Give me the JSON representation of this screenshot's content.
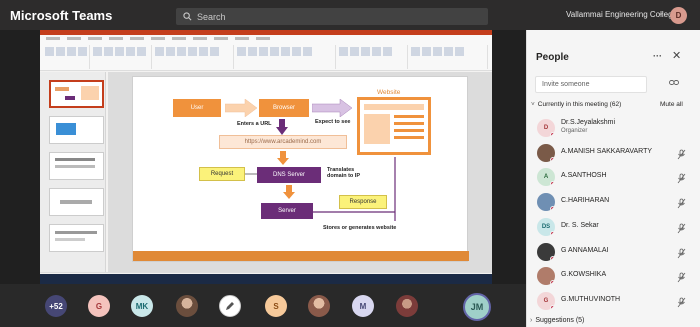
{
  "app": {
    "title": "Microsoft Teams",
    "search_placeholder": "Search",
    "org_name": "Vallammai Engineering College",
    "org_chevron": "⌄",
    "user_initials": "D"
  },
  "slide": {
    "user": "User",
    "browser": "Browser",
    "website": "Website",
    "expect": "Expect to see",
    "enters_url": "Enters a URL",
    "url": "https://www.arcademind.com",
    "request": "Request",
    "dns_server": "DNS Server",
    "translates": "Translates domain to IP",
    "response": "Response",
    "server": "Server",
    "stores": "Stores or generates website"
  },
  "strip": {
    "overflow": "+52",
    "avatars": [
      "G",
      "MK",
      "",
      "",
      "S",
      "",
      "M",
      ""
    ],
    "self_initials": "JM"
  },
  "panel": {
    "title": "People",
    "more": "···",
    "close": "✕",
    "invite_placeholder": "Invite someone",
    "section": "Currently in this meeting (62)",
    "mute_all": "Mute all",
    "suggestions": "Suggestions (5)",
    "people": [
      {
        "name": "Dr.S.Jeyalakshmi",
        "role": "Organizer",
        "initials": "D",
        "color": "#f3d6d8",
        "fg": "#a4373a"
      },
      {
        "name": "A.MANISH SAKKARAVARTY",
        "initials": "",
        "color": "#7a5a48",
        "fg": "#fff"
      },
      {
        "name": "A.SANTHOSH",
        "initials": "A",
        "color": "#cde6d4",
        "fg": "#2c6b3d"
      },
      {
        "name": "C.HARIHARAN",
        "initials": "",
        "color": "#6f8fb3",
        "fg": "#fff"
      },
      {
        "name": "Dr. S. Sekar",
        "initials": "DS",
        "color": "#c9e7e9",
        "fg": "#1b6b70"
      },
      {
        "name": "G ANNAMALAI",
        "initials": "",
        "color": "#3a3a3a",
        "fg": "#fff"
      },
      {
        "name": "G.KOWSHIKA",
        "initials": "",
        "color": "#b07c6a",
        "fg": "#fff"
      },
      {
        "name": "G.MUTHUVINOTH",
        "initials": "G",
        "color": "#f3d6d8",
        "fg": "#a4373a"
      }
    ]
  }
}
